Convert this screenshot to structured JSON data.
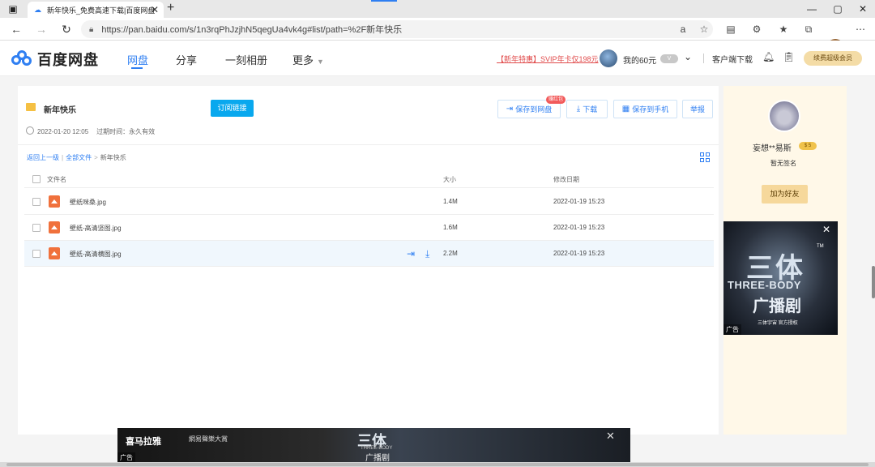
{
  "browser": {
    "tab_title": "新年快乐_免费高速下载|百度网盘",
    "new_tab_glyph": "+",
    "url": "https://pan.baidu.com/s/1n3rqPhJzjhN5qegUa4vk4g#list/path=%2F新年快乐"
  },
  "header": {
    "logo_text": "百度网盘",
    "nav": [
      "网盘",
      "分享",
      "一刻相册",
      "更多"
    ],
    "promo": "【新年特惠】SVIP年卡仅198元",
    "user_name": "我的60元",
    "client_download": "客户端下载",
    "renew_button": "续费超级会员"
  },
  "share": {
    "folder_name": "新年快乐",
    "subscribe_button": "订阅链接",
    "actions": {
      "save_to_disk": "保存到网盘",
      "save_tag": "赚红包",
      "download": "下载",
      "save_to_phone": "保存到手机",
      "report": "举报"
    },
    "created": "2022-01-20 12:05",
    "expire": "过期时间：永久有效",
    "breadcrumb": {
      "back": "返回上一级",
      "all": "全部文件",
      "current": "新年快乐"
    },
    "columns": {
      "name": "文件名",
      "size": "大小",
      "date": "修改日期"
    },
    "files": [
      {
        "name": "壁纸咪桑.jpg",
        "size": "1.4M",
        "date": "2022-01-19 15:23"
      },
      {
        "name": "壁纸-高清竖图.jpg",
        "size": "1.6M",
        "date": "2022-01-19 15:23"
      },
      {
        "name": "壁纸-高清横图.jpg",
        "size": "2.2M",
        "date": "2022-01-19 15:23"
      }
    ]
  },
  "sidebar": {
    "name": "妄想**易斯",
    "badge": "$ 5",
    "signature": "暂无签名",
    "add_friend": "加为好友",
    "ad": {
      "title": "三体",
      "subtitle": "THREE-BODY",
      "subtitle2": "广播剧",
      "license": "三体宇宙 官方授权",
      "tm": "TM",
      "label": "广告"
    }
  },
  "bottom_ad": {
    "brand": "喜马拉雅",
    "brand2": "網易聲樂大賞",
    "title": "三体",
    "subtitle": "THREE-BODY",
    "subtitle2": "广播剧",
    "label": "广告"
  },
  "icons": {
    "accent": "#2f7ff2",
    "file_color": "#f0713c",
    "folder_color": "#f5c043"
  }
}
